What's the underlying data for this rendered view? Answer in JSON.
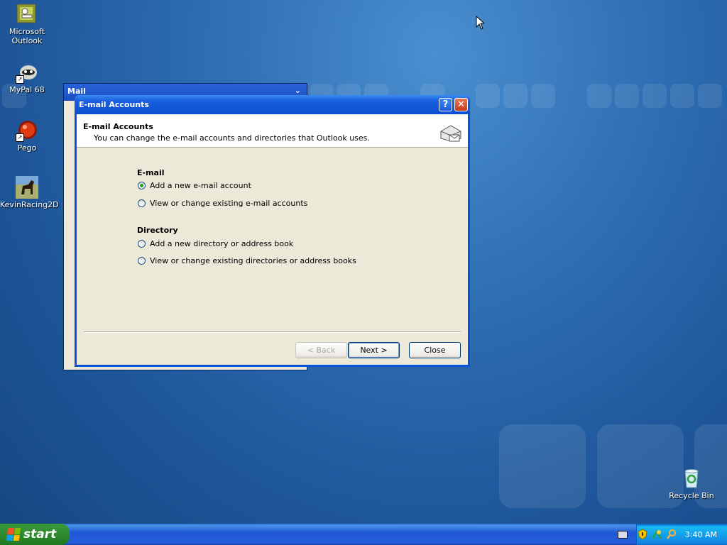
{
  "desktop": {
    "icons": [
      {
        "label": "Microsoft Outlook",
        "icon": "outlook-icon"
      },
      {
        "label": "MyPal 68",
        "icon": "mypal-icon"
      },
      {
        "label": "Pego",
        "icon": "pego-icon"
      },
      {
        "label": "KevinRacing2D",
        "icon": "horse-icon"
      },
      {
        "label": "Recycle Bin",
        "icon": "recycle-bin-icon"
      }
    ]
  },
  "background_window": {
    "title": "Mail"
  },
  "dialog": {
    "title": "E-mail Accounts",
    "header_title": "E-mail Accounts",
    "header_subtitle": "You can change the e-mail accounts and directories that Outlook uses.",
    "email_section": "E-mail",
    "email_options": [
      {
        "label": "Add a new e-mail account",
        "selected": true
      },
      {
        "label": "View or change existing e-mail accounts",
        "selected": false
      }
    ],
    "directory_section": "Directory",
    "directory_options": [
      {
        "label": "Add a new directory or address book",
        "selected": false
      },
      {
        "label": "View or change existing directories or address books",
        "selected": false
      }
    ],
    "buttons": {
      "back": "< Back",
      "next": "Next >",
      "close": "Close"
    }
  },
  "taskbar": {
    "start_label": "start",
    "clock": "3:40 AM"
  },
  "colors": {
    "desktop": "#1d5598",
    "title_bar": "#0b53d6",
    "start_button": "#2f8a2f"
  }
}
